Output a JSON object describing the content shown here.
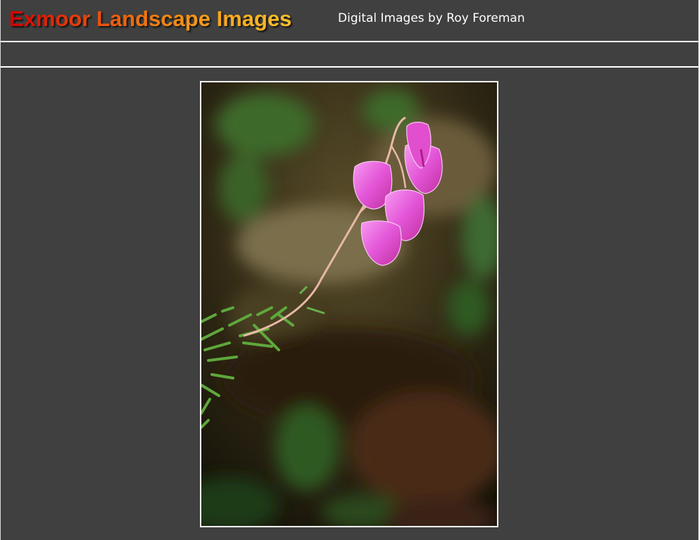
{
  "header": {
    "logo_text": "Exmoor Landscape Images",
    "byline": "Digital Images by Roy Foreman"
  },
  "photo": {
    "subject": "bell-heather-flower-photo"
  },
  "colors": {
    "background": "#404040",
    "rule": "#ffffff",
    "logo_gradient_start": "#d40000",
    "logo_gradient_end": "#fcc12a",
    "flower": "#e04ad0"
  }
}
